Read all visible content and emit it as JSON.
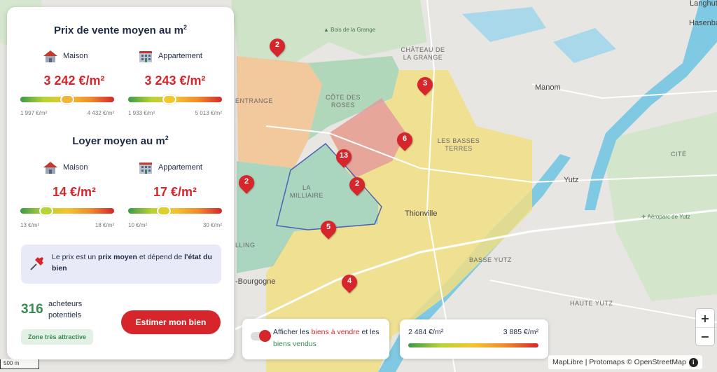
{
  "map": {
    "labels": [
      {
        "id": "bois",
        "text": "Bois de la Grange",
        "cls": "poi"
      },
      {
        "id": "chateau",
        "text": "CHÂTEAU DE LA GRANGE",
        "cls": ""
      },
      {
        "id": "cote",
        "text": "CÔTE DES ROSES",
        "cls": ""
      },
      {
        "id": "basses",
        "text": "LES BASSES TERRES",
        "cls": ""
      },
      {
        "id": "milliaire",
        "text": "LA MILLIAIRE",
        "cls": ""
      },
      {
        "id": "thionville",
        "text": "Thionville",
        "cls": "city"
      },
      {
        "id": "entrange",
        "text": "ENTRANGE",
        "cls": ""
      },
      {
        "id": "lling",
        "text": "LLING",
        "cls": ""
      },
      {
        "id": "bourgogne",
        "text": "-Bourgogne",
        "cls": "city"
      },
      {
        "id": "manom",
        "text": "Manom",
        "cls": "city"
      },
      {
        "id": "cite",
        "text": "CITÉ",
        "cls": ""
      },
      {
        "id": "yutz",
        "text": "Yutz",
        "cls": "city"
      },
      {
        "id": "aeroparc",
        "text": "Aéroparc de Yutz",
        "cls": "poi"
      },
      {
        "id": "basseyutz",
        "text": "BASSE YUTZ",
        "cls": ""
      },
      {
        "id": "hauteyutz",
        "text": "HAUTE YUTZ",
        "cls": ""
      },
      {
        "id": "langhuth",
        "text": "Langhuth",
        "cls": "city"
      },
      {
        "id": "hasenbach",
        "text": "Hasenba",
        "cls": "city"
      }
    ],
    "pins": [
      "2",
      "3",
      "6",
      "13",
      "2",
      "2",
      "5",
      "4"
    ]
  },
  "panel": {
    "sale_title": "Prix de vente moyen au m",
    "sale_title_sup": "2",
    "rent_title": "Loyer moyen au m",
    "rent_title_sup": "2",
    "house_label": "Maison",
    "apartment_label": "Appartement",
    "sale": {
      "house_price": "3 242 €/m²",
      "house_min": "1 997 €/m²",
      "house_max": "4 432 €/m²",
      "house_level": 0.5,
      "apartment_price": "3 243 €/m²",
      "apartment_min": "1 933 €/m²",
      "apartment_max": "5 013 €/m²",
      "apartment_level": 0.43
    },
    "rent": {
      "house_price": "14 €/m²",
      "house_min": "13 €/m²",
      "house_max": "18 €/m²",
      "house_level": 0.24,
      "apartment_price": "17 €/m²",
      "apartment_min": "10 €/m²",
      "apartment_max": "30 €/m²",
      "apartment_level": 0.36
    },
    "info": {
      "t1": "Le prix est un ",
      "b1": "prix moyen",
      "t2": " et dépend de ",
      "b2": "l'état du bien"
    },
    "buyers_count": "316",
    "buyers_label": "acheteurs potentiels",
    "zone_badge": "Zone très attractive",
    "estimate_button": "Estimer mon bien"
  },
  "toggle_card": {
    "t1": "Afficher les ",
    "red": "biens à vendre",
    "t2": " et les ",
    "green": "biens vendus"
  },
  "legend": {
    "min": "2 484 €/m²",
    "max": "3 885 €/m²"
  },
  "zoom": {
    "in": "+",
    "out": "−"
  },
  "attribution": "MapLibre | Protomaps © OpenStreetMap",
  "info_icon": "i",
  "scale": "500 m",
  "colors": {
    "accent": "#d6262b",
    "green": "#3a8a50",
    "info_bg": "#e8ebf7"
  }
}
